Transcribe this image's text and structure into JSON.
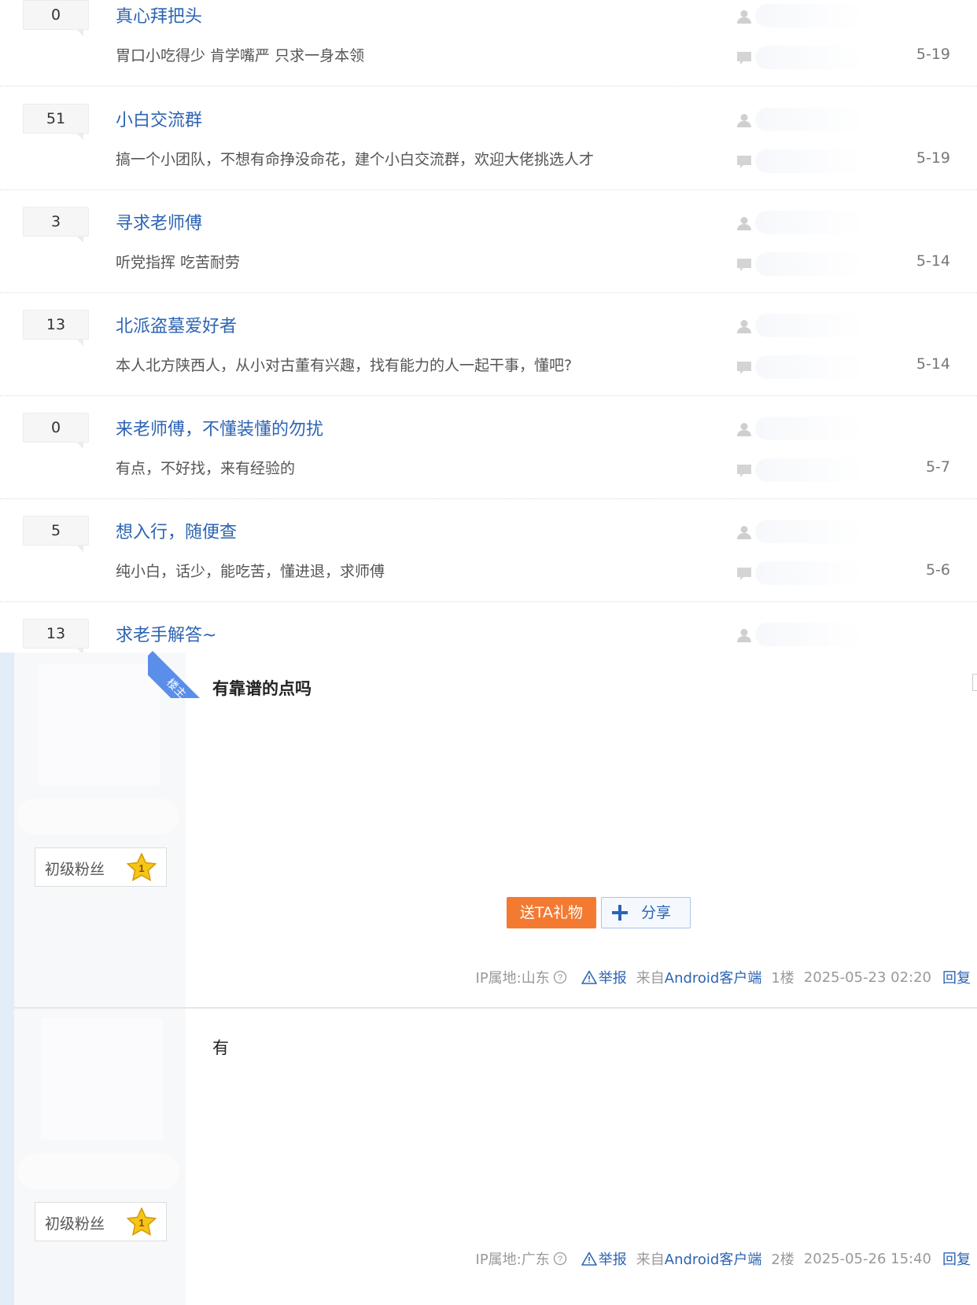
{
  "threads": [
    {
      "replies": "0",
      "title": "真心拜把头",
      "abstract": "胃口小吃得少 肯学嘴严 只求一身本领",
      "date": "5-19"
    },
    {
      "replies": "51",
      "title": "小白交流群",
      "abstract": "搞一个小团队，不想有命挣没命花，建个小白交流群，欢迎大佬挑选人才",
      "date": "5-19"
    },
    {
      "replies": "3",
      "title": "寻求老师傅",
      "abstract": "听党指挥 吃苦耐劳",
      "date": "5-14"
    },
    {
      "replies": "13",
      "title": "北派盗墓爱好者",
      "abstract": "本人北方陕西人，从小对古董有兴趣，找有能力的人一起干事，懂吧?",
      "date": "5-14"
    },
    {
      "replies": "0",
      "title": "来老师傅，不懂装懂的勿扰",
      "abstract": "有点，不好找，来有经验的",
      "date": "5-7"
    },
    {
      "replies": "5",
      "title": "想入行，随便查",
      "abstract": "纯小白，话少，能吃苦，懂进退，求师傅",
      "date": "5-6"
    },
    {
      "replies": "13",
      "title": "求老手解答~",
      "abstract": "",
      "date": ""
    }
  ],
  "posts": [
    {
      "ribbon": "楼主",
      "badge": "初级粉丝",
      "badge_level": "1",
      "content": "有靠谱的点吗",
      "gift_label": "送TA礼物",
      "share_label": "分享",
      "ip": "IP属地:山东",
      "report": "举报",
      "source_prefix": "来自",
      "source": "Android客户端",
      "floor": "1楼",
      "time": "2025-05-23 02:20",
      "reply": "回复"
    },
    {
      "badge": "初级粉丝",
      "badge_level": "1",
      "content": "有",
      "ip": "IP属地:广东",
      "report": "举报",
      "source_prefix": "来自",
      "source": "Android客户端",
      "floor": "2楼",
      "time": "2025-05-26 15:40",
      "reply": "回复"
    }
  ],
  "colors": {
    "link": "#2d64b3",
    "gift": "#f47a32",
    "ribbon": "#5a8ee8",
    "star": "#f5c518"
  }
}
